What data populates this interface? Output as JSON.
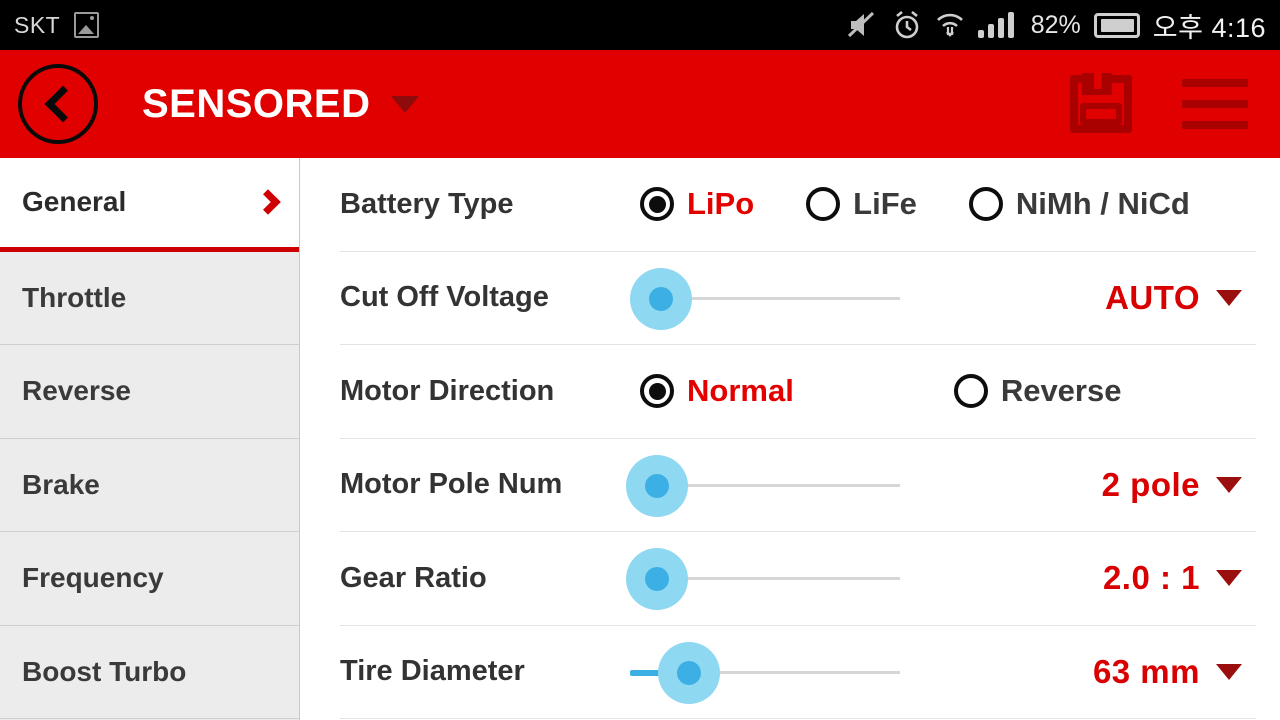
{
  "status_bar": {
    "carrier": "SKT",
    "gallery_icon": "image-icon",
    "mute_icon": "mute-icon",
    "alarm_icon": "alarm-clock-icon",
    "wifi_icon": "wifi-icon",
    "signal_icon": "cellular-signal-icon",
    "battery_percent": "82%",
    "battery_icon": "battery-icon",
    "time": "오후 4:16"
  },
  "app_bar": {
    "back_icon": "back-arrow-icon",
    "title": "SENSORED",
    "title_caret": "chevron-down-icon",
    "save_icon": "save-floppy-icon",
    "menu_icon": "hamburger-menu-icon"
  },
  "sidebar": {
    "items": [
      {
        "label": "General",
        "active": true
      },
      {
        "label": "Throttle",
        "active": false
      },
      {
        "label": "Reverse",
        "active": false
      },
      {
        "label": "Brake",
        "active": false
      },
      {
        "label": "Frequency",
        "active": false
      },
      {
        "label": "Boost Turbo",
        "active": false
      }
    ]
  },
  "settings": {
    "battery_type": {
      "label": "Battery Type",
      "options": [
        {
          "label": "LiPo",
          "selected": true
        },
        {
          "label": "LiFe",
          "selected": false
        },
        {
          "label": "NiMh / NiCd",
          "selected": false
        }
      ]
    },
    "cut_off_voltage": {
      "label": "Cut Off Voltage",
      "value": "AUTO",
      "slider_percent": 0
    },
    "motor_direction": {
      "label": "Motor Direction",
      "options": [
        {
          "label": "Normal",
          "selected": true
        },
        {
          "label": "Reverse",
          "selected": false
        }
      ]
    },
    "motor_pole_num": {
      "label": "Motor Pole Num",
      "value": "2 pole",
      "slider_percent": 0
    },
    "gear_ratio": {
      "label": "Gear Ratio",
      "value": "2.0 : 1",
      "slider_percent": 0
    },
    "tire_diameter": {
      "label": "Tire Diameter",
      "value": "63 mm",
      "slider_percent": 12
    }
  },
  "colors": {
    "accent_red": "#e00000",
    "value_red": "#d80000",
    "slider_blue": "#3cb0e5",
    "slider_halo": "#8ed8f2",
    "sidebar_bg": "#ececec"
  }
}
